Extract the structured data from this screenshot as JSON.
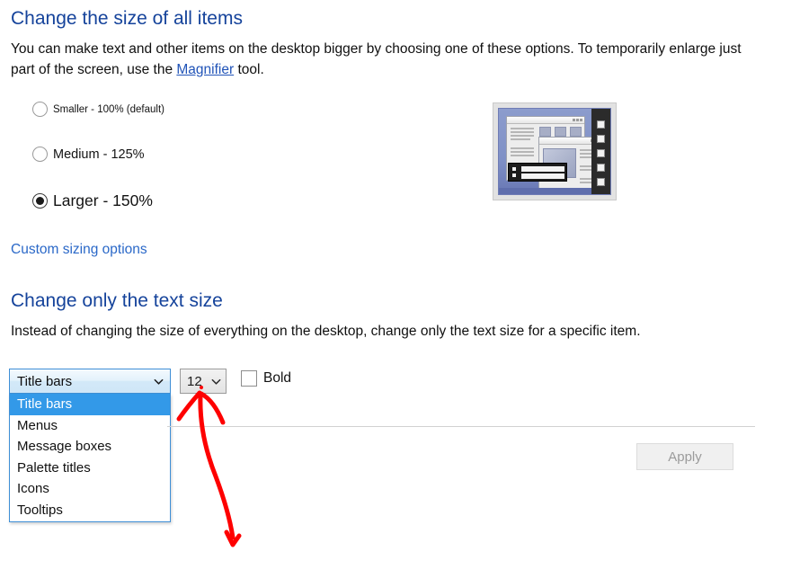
{
  "headings": {
    "size_section": "Change the size of all items",
    "text_section": "Change only the text size"
  },
  "intro": {
    "part1": "You can make text and other items on the desktop bigger by choosing one of these options. To temporarily enlarge just part of the screen, use the ",
    "link": "Magnifier",
    "part2": " tool."
  },
  "scaling_options": [
    {
      "label": "Smaller - 100% (default)",
      "checked": false
    },
    {
      "label": "Medium - 125%",
      "checked": false
    },
    {
      "label": "Larger - 150%",
      "checked": true
    }
  ],
  "custom_sizing_link": "Custom sizing options",
  "text_size_intro": "Instead of changing the size of everything on the desktop, change only the text size for a specific item.",
  "item_combobox": {
    "value": "Title bars",
    "expanded": true,
    "options": [
      "Title bars",
      "Menus",
      "Message boxes",
      "Palette titles",
      "Icons",
      "Tooltips"
    ],
    "selected_index": 0
  },
  "size_combobox": {
    "value": "12"
  },
  "bold_checkbox": {
    "label": "Bold",
    "checked": false
  },
  "apply_button": {
    "label": "Apply",
    "enabled": false
  },
  "annotation": {
    "color": "#fe0000",
    "shape": "hand-drawn-arrow-pointing-to-size-dropdown"
  },
  "colors": {
    "heading_blue": "#15439b",
    "link_blue": "#2a68c8",
    "highlight_blue": "#3399e8",
    "combobox_border_blue": "#3f8fd6",
    "annotation_red": "#fe0000"
  },
  "display_preview": {
    "name": "display-scaling-preview-thumbnail"
  }
}
